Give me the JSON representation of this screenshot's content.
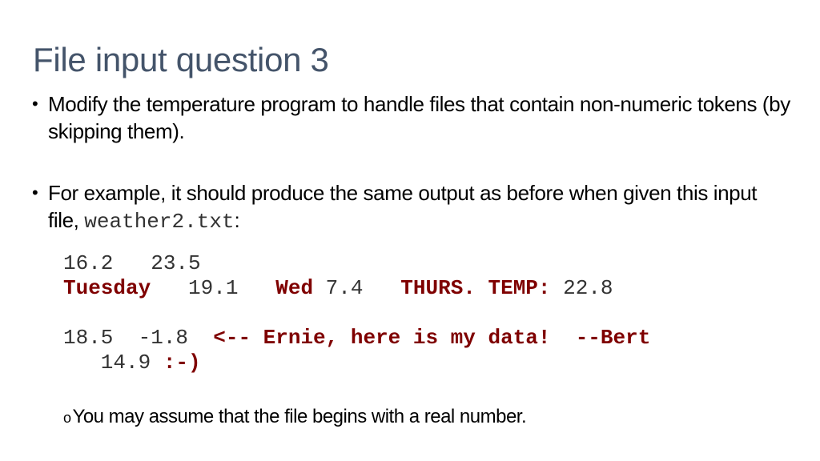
{
  "slide": {
    "title": "File input question 3",
    "bullets": [
      {
        "marker": "•",
        "text": "Modify the temperature program to handle files that contain non-numeric tokens (by skipping them)."
      },
      {
        "marker": "•",
        "text_before": "For example, it should produce the same output as before when given this input file, ",
        "filename": "weather2.txt",
        "text_after": ":"
      }
    ],
    "file_contents": {
      "lines": [
        [
          {
            "text": "16.2   23.5",
            "kind": "number"
          }
        ],
        [
          {
            "text": "Tuesday",
            "kind": "token"
          },
          {
            "text": "   19.1   ",
            "kind": "number"
          },
          {
            "text": "Wed",
            "kind": "token"
          },
          {
            "text": " 7.4   ",
            "kind": "number"
          },
          {
            "text": "THURS. TEMP:",
            "kind": "token"
          },
          {
            "text": " 22.8",
            "kind": "number"
          }
        ],
        [
          {
            "text": " ",
            "kind": "number"
          }
        ],
        [
          {
            "text": "18.5  -1.8  ",
            "kind": "number"
          },
          {
            "text": "<-- Ernie, here is my data!  --Bert",
            "kind": "token"
          }
        ],
        [
          {
            "text": "   14.9 ",
            "kind": "number"
          },
          {
            "text": ":-)",
            "kind": "token"
          }
        ]
      ]
    },
    "sub_bullet": {
      "marker": "o",
      "text": "You may assume that the file begins with a real number."
    },
    "colors": {
      "title": "#44546a",
      "body_text": "#000000",
      "code_number": "#333333",
      "code_token": "#7f0000"
    }
  }
}
